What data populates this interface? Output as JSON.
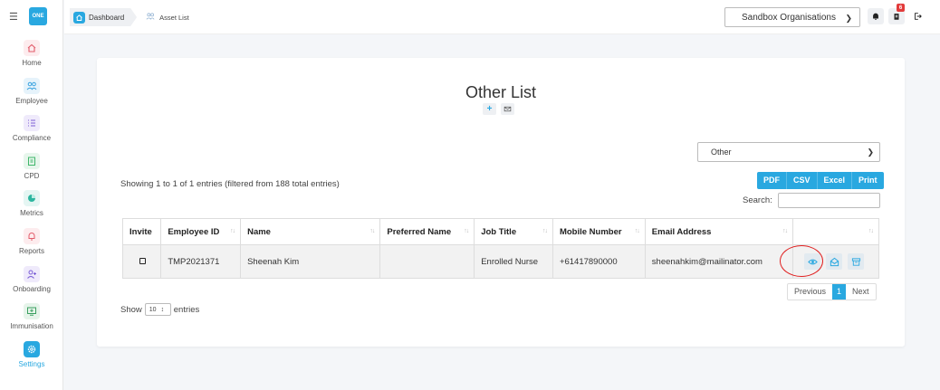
{
  "sidebar": {
    "logo_text": "ONE",
    "items": [
      {
        "label": "Home",
        "color": "#e25b6a",
        "icon": "home-icon"
      },
      {
        "label": "Employee",
        "color": "#3aa3e0",
        "icon": "users-icon"
      },
      {
        "label": "Compliance",
        "color": "#7c5fd6",
        "icon": "list-icon"
      },
      {
        "label": "CPD",
        "color": "#3fb66a",
        "icon": "clipboard-icon"
      },
      {
        "label": "Metrics",
        "color": "#2db6a0",
        "icon": "pie-icon"
      },
      {
        "label": "Reports",
        "color": "#e25b6a",
        "icon": "bell-icon"
      },
      {
        "label": "Onboarding",
        "color": "#7c5fd6",
        "icon": "user-plus-icon"
      },
      {
        "label": "Immunisation",
        "color": "#3aa060",
        "icon": "monitor-plus-icon"
      },
      {
        "label": "Settings",
        "color": "#ffffff",
        "icon": "gear-icon",
        "active": true
      }
    ]
  },
  "breadcrumb": {
    "home": "Dashboard",
    "current": "Asset List"
  },
  "header": {
    "org": "Sandbox Organisations",
    "badge_count": "6"
  },
  "page": {
    "title": "Other List",
    "type_select": "Other",
    "export": [
      "PDF",
      "CSV",
      "Excel",
      "Print"
    ],
    "info": "Showing 1 to 1 of 1 entries (filtered from 188 total entries)",
    "search_label": "Search:",
    "columns": [
      "Invite",
      "Employee ID",
      "Name",
      "Preferred Name",
      "Job Title",
      "Mobile Number",
      "Email Address",
      ""
    ],
    "rows": [
      {
        "employee_id": "TMP2021371",
        "name": "Sheenah Kim",
        "preferred_name": "",
        "job_title": "Enrolled Nurse",
        "mobile": "+61417890000",
        "email": "sheenahkim@mailinator.com"
      }
    ],
    "pager": {
      "previous": "Previous",
      "current": "1",
      "next": "Next"
    },
    "show_prefix": "Show",
    "show_value": "10",
    "show_suffix": "entries"
  },
  "accent": "#29a8e0"
}
